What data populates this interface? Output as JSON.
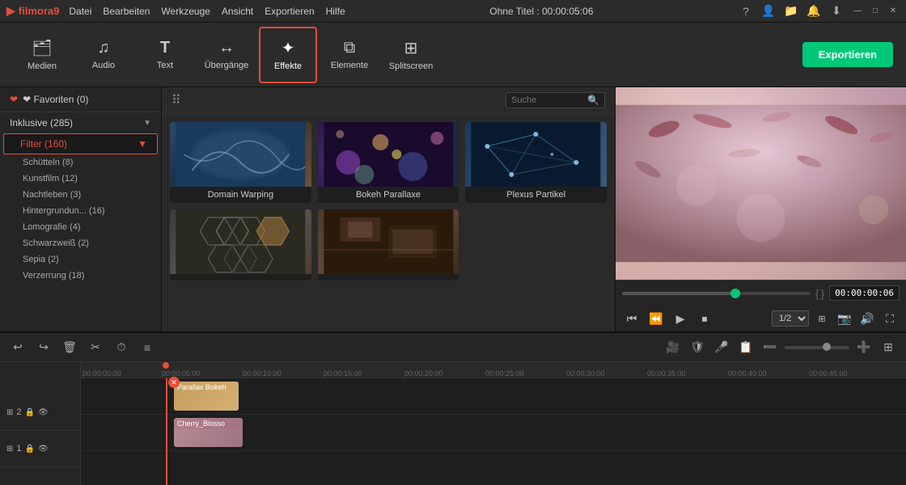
{
  "titlebar": {
    "logo": "filmora9",
    "logo_icon": "▶",
    "menu": [
      "Datei",
      "Bearbeiten",
      "Werkzeuge",
      "Ansicht",
      "Exportieren",
      "Hilfe"
    ],
    "title": "Ohne Titel : 00:00:05:06",
    "win_buttons": [
      "?",
      "👤",
      "📁",
      "🔔",
      "⬇",
      "—",
      "□",
      "✕"
    ]
  },
  "toolbar": {
    "tools": [
      {
        "id": "medien",
        "icon": "🗂",
        "label": "Medien"
      },
      {
        "id": "audio",
        "icon": "🎵",
        "label": "Audio"
      },
      {
        "id": "text",
        "icon": "T",
        "label": "Text"
      },
      {
        "id": "uebergaenge",
        "icon": "↔",
        "label": "Übergänge"
      },
      {
        "id": "effekte",
        "icon": "✦",
        "label": "Effekte"
      },
      {
        "id": "elemente",
        "icon": "⧉",
        "label": "Elemente"
      },
      {
        "id": "splitscreen",
        "icon": "⊞",
        "label": "Splitscreen"
      }
    ],
    "active_tool": "effekte",
    "export_label": "Exportieren"
  },
  "sidebar": {
    "favorites": "❤ Favoriten (0)",
    "categories": [
      {
        "name": "Inklusive (285)",
        "expanded": true
      },
      {
        "name": "Filter (160)",
        "expanded": true,
        "highlighted": true
      },
      {
        "name": "Schütteln (8)",
        "sub": true
      },
      {
        "name": "Kunstfilm (12)",
        "sub": true
      },
      {
        "name": "Nachtleben (3)",
        "sub": true
      },
      {
        "name": "Hintergrundun... (16)",
        "sub": true
      },
      {
        "name": "Lomografie (4)",
        "sub": true
      },
      {
        "name": "Schwarzweiß (2)",
        "sub": true
      },
      {
        "name": "Sepia (2)",
        "sub": true
      },
      {
        "name": "Verzerrung (18)",
        "sub": true
      }
    ]
  },
  "effects": {
    "search_placeholder": "Suche",
    "grid": [
      {
        "id": "domain_warping",
        "label": "Domain Warping",
        "thumb": "domain"
      },
      {
        "id": "bokeh_parallaxe",
        "label": "Bokeh Parallaxe",
        "thumb": "bokeh"
      },
      {
        "id": "plexus_partikel",
        "label": "Plexus Partikel",
        "thumb": "plexus"
      },
      {
        "id": "hexa",
        "label": "",
        "thumb": "hexa"
      },
      {
        "id": "photo",
        "label": "",
        "thumb": "photo"
      }
    ]
  },
  "preview": {
    "time": "00:00:00:06",
    "quality": "1/2",
    "playback_btns": [
      "⏮",
      "⏪",
      "▶",
      "⏹"
    ]
  },
  "timeline": {
    "toolbar_btns": [
      "↩",
      "↪",
      "🗑",
      "✂",
      "⏱",
      "≡"
    ],
    "ruler_marks": [
      "00:00:00:00",
      "00:00:05:00",
      "00:00:10:00",
      "00:00:15:00",
      "00:00:20:00",
      "00:00:25:00",
      "00:00:30:00",
      "00:00:35:00",
      "00:00:40:00",
      "00:00:45:00"
    ],
    "tracks": [
      {
        "id": "track2",
        "label": "2",
        "icons": [
          "⊞",
          "🔒",
          "👁"
        ]
      },
      {
        "id": "track1",
        "label": "1",
        "icons": [
          "⊞",
          "🔒",
          "👁"
        ]
      }
    ],
    "clips": [
      {
        "id": "parallax_bokeh",
        "label": "Parallax Bokeh",
        "track": "track2"
      },
      {
        "id": "cherry_blosso",
        "label": "Cherry_Blosso",
        "track": "track1"
      }
    ],
    "right_btns": [
      "🎥",
      "🛡",
      "🎤",
      "📋",
      "⬜",
      "➖",
      "●",
      "➕",
      "⊞"
    ]
  }
}
